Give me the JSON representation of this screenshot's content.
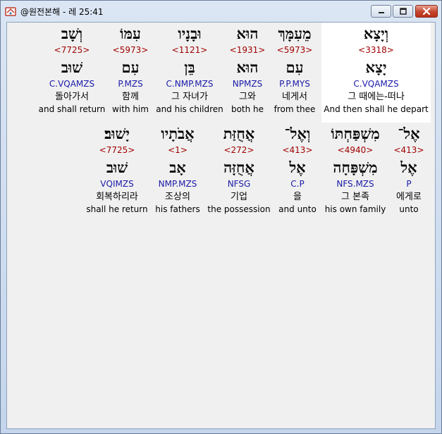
{
  "window": {
    "title": "@원전본해 - 레 25:41",
    "icon": "bible-app-icon",
    "controls": [
      "minimize-icon",
      "maximize-icon",
      "close-icon"
    ]
  },
  "rows": [
    [
      {
        "heb": "וְיָצָא",
        "strong": "<3318>",
        "heb_root": "יָצָא",
        "morph": "C.VQAMZS",
        "kor": "그 때에는-떠나",
        "eng": "And then shall he depart",
        "selected": true
      },
      {
        "heb": "מֵעִמָּךְ",
        "strong": "<5973>",
        "heb_root": "עִם",
        "morph": "P.P.MYS",
        "kor": "네게서",
        "eng": "from thee"
      },
      {
        "heb": "הוּא",
        "strong": "<1931>",
        "heb_root": "הוּא",
        "morph": "NPMZS",
        "kor": "그와",
        "eng": "both he"
      },
      {
        "heb": "וּבָנָיו",
        "strong": "<1121>",
        "heb_root": "בֵּן",
        "morph": "C.NMP.MZS",
        "kor": "그 자녀가",
        "eng": "and his children"
      },
      {
        "heb": "עִמּוֹ",
        "strong": "<5973>",
        "heb_root": "עִם",
        "morph": "P.MZS",
        "kor": "함께",
        "eng": "with him"
      },
      {
        "heb": "וְשָׁב",
        "strong": "<7725>",
        "heb_root": "שׁוּב",
        "morph": "C.VQAMZS",
        "kor": "돌아가서",
        "eng": "and shall return"
      }
    ],
    [
      {
        "heb": "אֶל־",
        "strong": "<413>",
        "heb_root": "אֶל",
        "morph": "P",
        "kor": "에게로",
        "eng": "unto"
      },
      {
        "heb": "מִשְׁפַּחְתּוֹ",
        "strong": "<4940>",
        "heb_root": "מִשְׁפָּחָה",
        "morph": "NFS.MZS",
        "kor": "그 본족",
        "eng": "his own family"
      },
      {
        "heb": "וְאֶל־",
        "strong": "<413>",
        "heb_root": "אֶל",
        "morph": "C.P",
        "kor": "을",
        "eng": "and unto"
      },
      {
        "heb": "אֲחֻזַּת",
        "strong": "<272>",
        "heb_root": "אֲחֻזָּה",
        "morph": "NFSG",
        "kor": "기업",
        "eng": "the possession"
      },
      {
        "heb": "אֲבֹתָיו",
        "strong": "<1>",
        "heb_root": "אָב",
        "morph": "NMP.MZS",
        "kor": "조상의",
        "eng": "his fathers"
      },
      {
        "heb": "יָשׁוּב׃",
        "strong": "<7725>",
        "heb_root": "שׁוּב",
        "morph": "VQIMZS",
        "kor": "회복하리라",
        "eng": "shall he return"
      }
    ]
  ]
}
